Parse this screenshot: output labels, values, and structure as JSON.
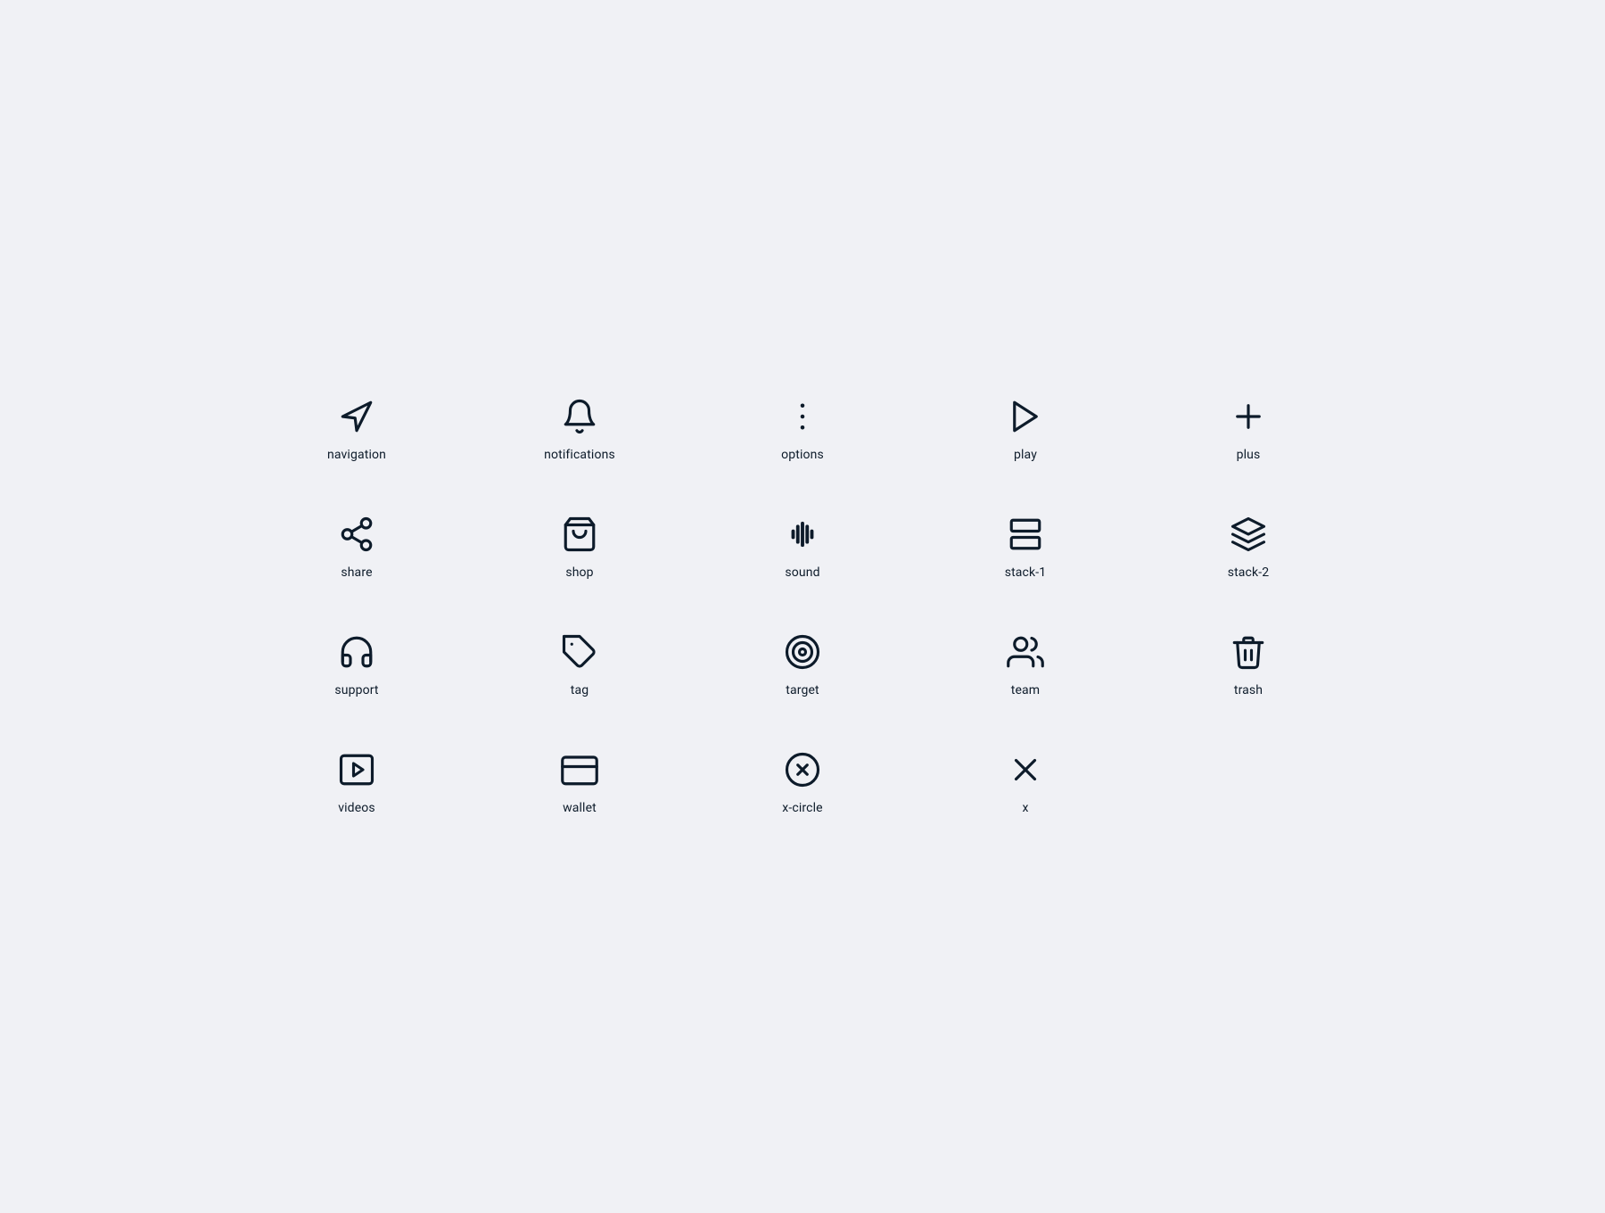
{
  "icons": [
    {
      "name": "navigation",
      "label": "navigation"
    },
    {
      "name": "notifications",
      "label": "notifications"
    },
    {
      "name": "options",
      "label": "options"
    },
    {
      "name": "play",
      "label": "play"
    },
    {
      "name": "plus",
      "label": "plus"
    },
    {
      "name": "share",
      "label": "share"
    },
    {
      "name": "shop",
      "label": "shop"
    },
    {
      "name": "sound",
      "label": "sound"
    },
    {
      "name": "stack-1",
      "label": "stack-1"
    },
    {
      "name": "stack-2",
      "label": "stack-2"
    },
    {
      "name": "support",
      "label": "support"
    },
    {
      "name": "tag",
      "label": "tag"
    },
    {
      "name": "target",
      "label": "target"
    },
    {
      "name": "team",
      "label": "team"
    },
    {
      "name": "trash",
      "label": "trash"
    },
    {
      "name": "videos",
      "label": "videos"
    },
    {
      "name": "wallet",
      "label": "wallet"
    },
    {
      "name": "x-circle",
      "label": "x-circle"
    },
    {
      "name": "x",
      "label": "x"
    }
  ]
}
